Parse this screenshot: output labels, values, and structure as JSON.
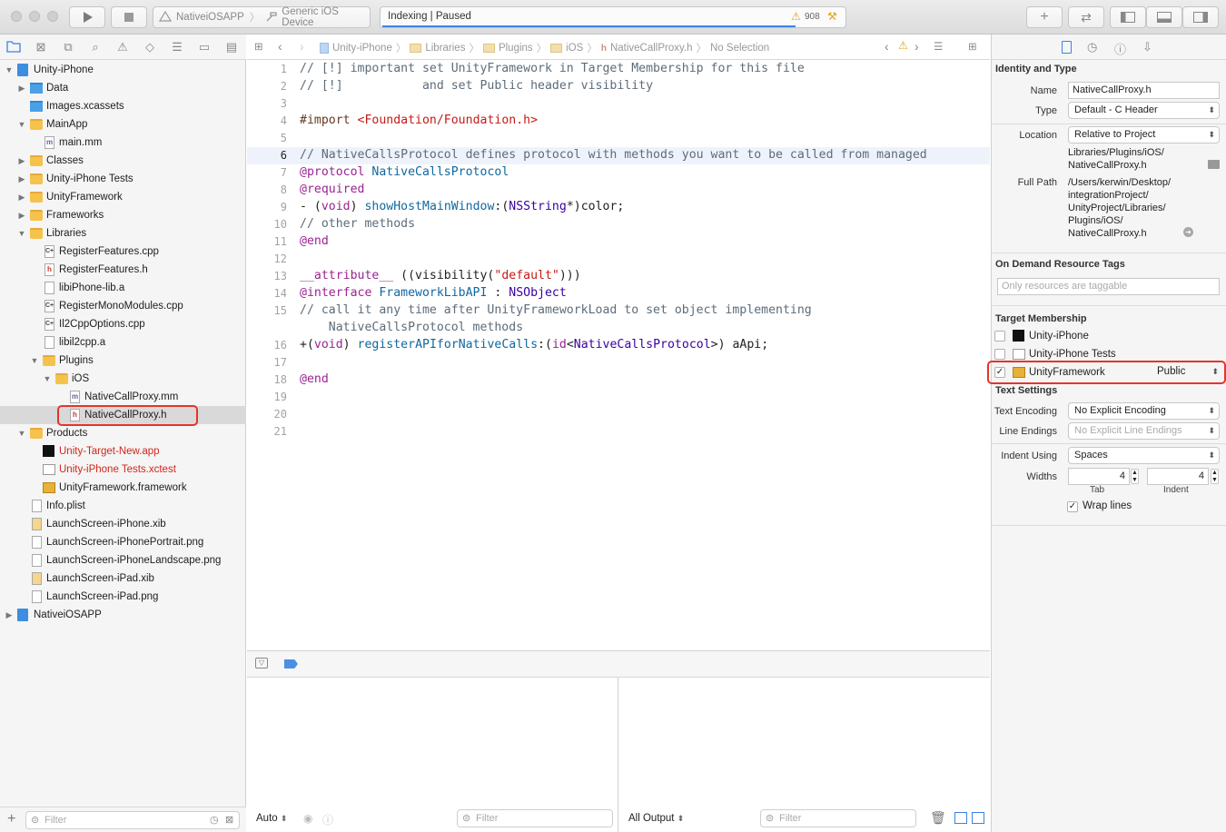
{
  "toolbar": {
    "scheme": "NativeiOSAPP",
    "device": "Generic iOS Device",
    "activity": "Indexing | Paused",
    "warning_count": "908"
  },
  "jumpbar": {
    "crumbs": [
      "Unity-iPhone",
      "Libraries",
      "Plugins",
      "iOS",
      "NativeCallProxy.h",
      "No Selection"
    ]
  },
  "navigator": {
    "rows": [
      {
        "label": "Unity-iPhone"
      },
      {
        "label": "Data"
      },
      {
        "label": "Images.xcassets"
      },
      {
        "label": "MainApp"
      },
      {
        "label": "main.mm"
      },
      {
        "label": "Classes"
      },
      {
        "label": "Unity-iPhone Tests"
      },
      {
        "label": "UnityFramework"
      },
      {
        "label": "Frameworks"
      },
      {
        "label": "Libraries"
      },
      {
        "label": "RegisterFeatures.cpp"
      },
      {
        "label": "RegisterFeatures.h"
      },
      {
        "label": "libiPhone-lib.a"
      },
      {
        "label": "RegisterMonoModules.cpp"
      },
      {
        "label": "Il2CppOptions.cpp"
      },
      {
        "label": "libil2cpp.a"
      },
      {
        "label": "Plugins"
      },
      {
        "label": "iOS"
      },
      {
        "label": "NativeCallProxy.mm"
      },
      {
        "label": "NativeCallProxy.h"
      },
      {
        "label": "Products"
      },
      {
        "label": "Unity-Target-New.app"
      },
      {
        "label": "Unity-iPhone Tests.xctest"
      },
      {
        "label": "UnityFramework.framework"
      },
      {
        "label": "Info.plist"
      },
      {
        "label": "LaunchScreen-iPhone.xib"
      },
      {
        "label": "LaunchScreen-iPhonePortrait.png"
      },
      {
        "label": "LaunchScreen-iPhoneLandscape.png"
      },
      {
        "label": "LaunchScreen-iPad.xib"
      },
      {
        "label": "LaunchScreen-iPad.png"
      },
      {
        "label": "NativeiOSAPP"
      }
    ],
    "filter_placeholder": "Filter"
  },
  "editor": {
    "line_numbers": [
      "1",
      "2",
      "3",
      "4",
      "5",
      "6",
      "7",
      "8",
      "9",
      "10",
      "11",
      "12",
      "13",
      "14",
      "15",
      "",
      "16",
      "17",
      "18",
      "19",
      "20",
      "21"
    ],
    "current_line": "6",
    "lines": {
      "l1": "// [!] important set UnityFramework in Target Membership for this file",
      "l2": "// [!]           and set Public header visibility",
      "l4a": "#import ",
      "l4b": "<Foundation/Foundation.h>",
      "l6": "// NativeCallsProtocol defines protocol with methods you want to be called from managed",
      "l7a": "@protocol",
      "l7b": " NativeCallsProtocol",
      "l8": "@required",
      "l9a": "- (",
      "l9b": "void",
      "l9c": ") ",
      "l9d": "showHostMainWindow",
      "l9e": ":(",
      "l9f": "NSString",
      "l9g": "*)color;",
      "l10": "// other methods",
      "l11": "@end",
      "l13a": "__attribute__",
      "l13b": " ((visibility(",
      "l13c": "\"default\"",
      "l13d": ")))",
      "l14a": "@interface",
      "l14b": " FrameworkLibAPI",
      "l14c": " : ",
      "l14d": "NSObject",
      "l15a": "// call it any time after UnityFrameworkLoad to set object implementing",
      "l15b": "    NativeCallsProtocol methods",
      "l16a": "+(",
      "l16b": "void",
      "l16c": ") ",
      "l16d": "registerAPIforNativeCalls",
      "l16e": ":(",
      "l16f": "id",
      "l16g": "<",
      "l16h": "NativeCallsProtocol",
      "l16i": ">) aApi;",
      "l18": "@end"
    }
  },
  "debug": {
    "auto_label": "Auto",
    "filter_placeholder": "Filter",
    "output_label": "All Output"
  },
  "inspector": {
    "identity": {
      "header": "Identity and Type",
      "name_label": "Name",
      "name_value": "NativeCallProxy.h",
      "type_label": "Type",
      "type_value": "Default - C Header",
      "location_label": "Location",
      "location_value": "Relative to Project",
      "location_path": [
        "Libraries/Plugins/iOS/",
        "NativeCallProxy.h"
      ],
      "fullpath_label": "Full Path",
      "fullpath_value": [
        "/Users/kerwin/Desktop/",
        "integrationProject/",
        "UnityProject/Libraries/",
        "Plugins/iOS/",
        "NativeCallProxy.h"
      ]
    },
    "ondemand": {
      "header": "On Demand Resource Tags",
      "placeholder": "Only resources are taggable"
    },
    "membership": {
      "header": "Target Membership",
      "targets": [
        {
          "name": "Unity-iPhone",
          "checked": false
        },
        {
          "name": "Unity-iPhone Tests",
          "checked": false
        },
        {
          "name": "UnityFramework",
          "checked": true,
          "visibility": "Public"
        }
      ]
    },
    "text": {
      "header": "Text Settings",
      "encoding_label": "Text Encoding",
      "encoding_value": "No Explicit Encoding",
      "endings_label": "Line Endings",
      "endings_value": "No Explicit Line Endings",
      "indent_label": "Indent Using",
      "indent_value": "Spaces",
      "widths_label": "Widths",
      "tab_value": "4",
      "indent_width_value": "4",
      "tab_label": "Tab",
      "indent_label2": "Indent",
      "wrap_label": "Wrap lines"
    }
  },
  "colors": {
    "highlight": "#e5352a",
    "comment": "#5d6c79",
    "keyword": "#9b2393",
    "string": "#c41a16",
    "product_missing": "#d0261a"
  }
}
